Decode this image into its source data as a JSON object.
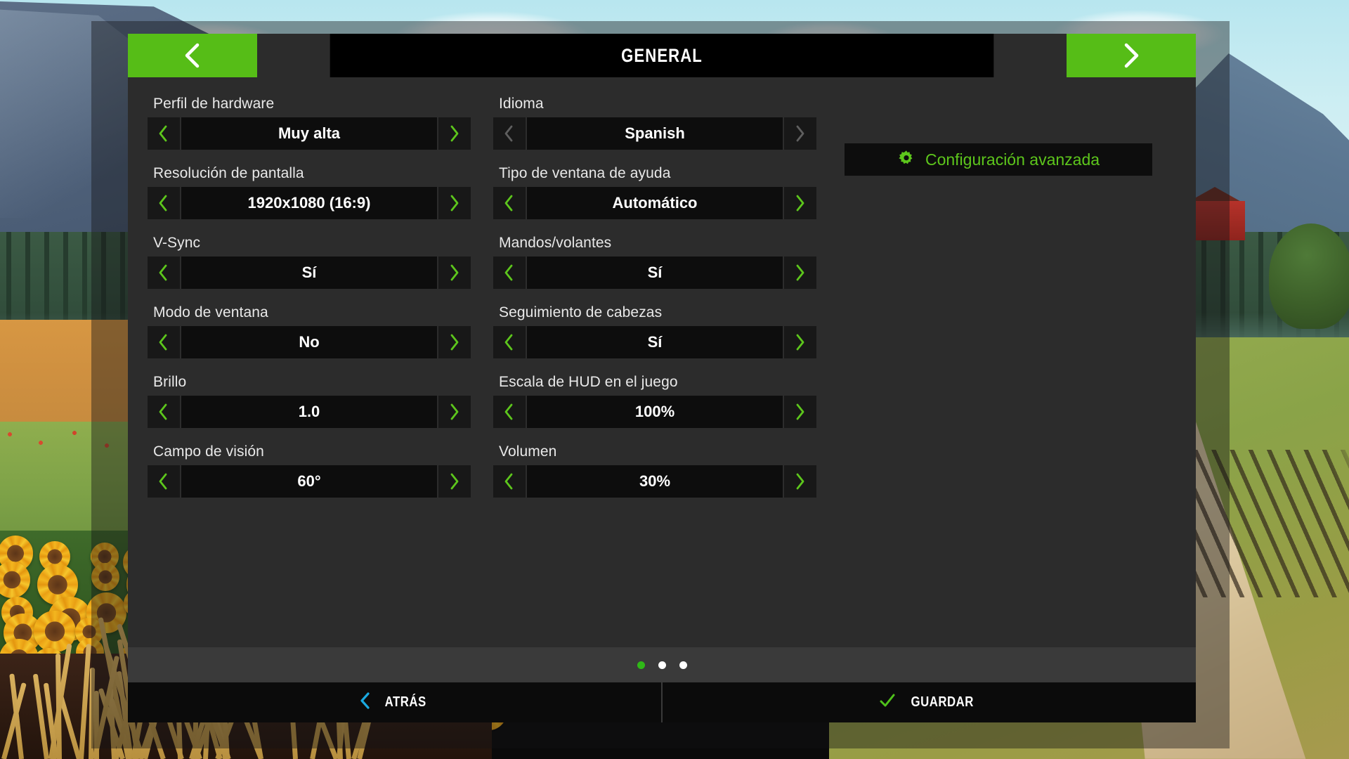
{
  "header": {
    "title": "GENERAL",
    "prev_icon": "chevron-left-icon",
    "next_icon": "chevron-right-icon"
  },
  "colors": {
    "accent_green": "#56bd17",
    "arrow_green": "#5dc61c",
    "arrow_disabled": "#5f5f5f",
    "panel_bg": "#2c2c2c",
    "value_bg": "#0d0d0d",
    "arrow_bg": "#181818",
    "pager_bg": "#3a3a3a",
    "footer_bg": "#0b0b0b",
    "back_chevron": "#1ba9e0",
    "check_green": "#4fc11b",
    "dot_active": "#2fb817"
  },
  "settings_left": [
    {
      "label": "Perfil de hardware",
      "value": "Muy alta",
      "enabled": true
    },
    {
      "label": "Resolución de pantalla",
      "value": "1920x1080 (16:9)",
      "enabled": true
    },
    {
      "label": "V-Sync",
      "value": "Sí",
      "enabled": true
    },
    {
      "label": "Modo de ventana",
      "value": "No",
      "enabled": true
    },
    {
      "label": "Brillo",
      "value": "1.0",
      "enabled": true
    },
    {
      "label": "Campo de visión",
      "value": "60°",
      "enabled": true
    }
  ],
  "settings_right": [
    {
      "label": "Idioma",
      "value": "Spanish",
      "enabled": false
    },
    {
      "label": "Tipo de ventana de ayuda",
      "value": "Automático",
      "enabled": true
    },
    {
      "label": "Mandos/volantes",
      "value": "Sí",
      "enabled": true
    },
    {
      "label": "Seguimiento de cabezas",
      "value": "Sí",
      "enabled": true
    },
    {
      "label": "Escala de HUD en el juego",
      "value": "100%",
      "enabled": true
    },
    {
      "label": "Volumen",
      "value": "30%",
      "enabled": true
    }
  ],
  "advanced": {
    "label": "Configuración avanzada",
    "icon": "gear-icon"
  },
  "pager": {
    "total_pages": 3,
    "active_page": 1
  },
  "footer": {
    "back_label": "ATRÁS",
    "back_icon": "chevron-left-icon",
    "save_label": "GUARDAR",
    "save_icon": "check-icon"
  }
}
